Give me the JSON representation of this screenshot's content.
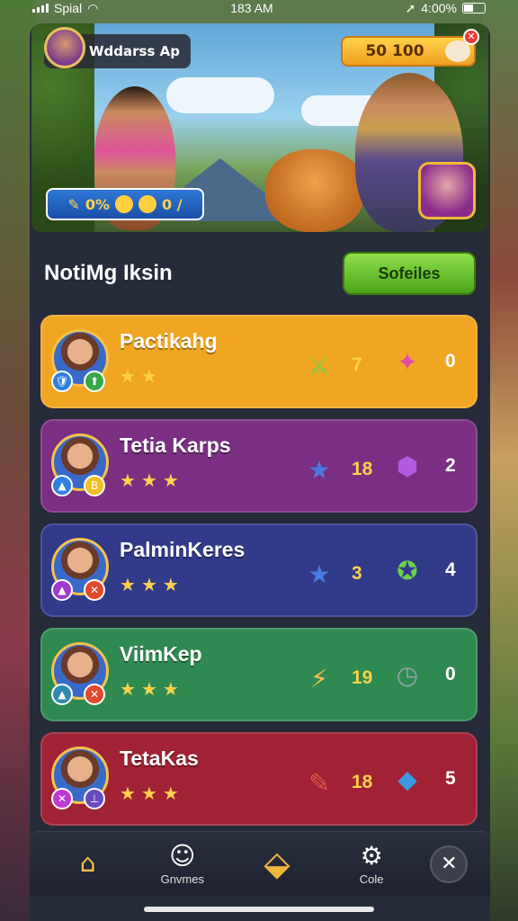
{
  "status_bar": {
    "carrier": "Spial",
    "time": "183 AM",
    "battery": "4:00%"
  },
  "hero": {
    "profile_name": "Wddarss Ap",
    "coins": "50 100",
    "stat": "0%",
    "stat_value": "0 /"
  },
  "section": {
    "title": "NotiMg Iksin",
    "action_label": "Sofeiles"
  },
  "players": [
    {
      "name": "Pactikahg",
      "stars": 2,
      "stat_a": "7",
      "stat_b": "0",
      "color": "#f0a622",
      "icon_a": "sword-icon",
      "icon_b": "ninja-icon",
      "badge_a_color": "#2f7fe0",
      "badge_b_color": "#3aa84a",
      "badge_a": "🛡",
      "badge_b": "⬆"
    },
    {
      "name": "Tetia Karps",
      "stars": 3,
      "stat_a": "18",
      "stat_b": "2",
      "color": "#7a2f82",
      "icon_a": "star-icon",
      "icon_b": "gem-icon",
      "badge_a_color": "#2f7fe0",
      "badge_b_color": "#f0c020",
      "badge_a": "▲",
      "badge_b": "B"
    },
    {
      "name": "PalminKeres",
      "stars": 3,
      "stat_a": "3",
      "stat_b": "4",
      "color": "#323a8a",
      "icon_a": "star-icon",
      "icon_b": "compass-icon",
      "badge_a_color": "#a03ad0",
      "badge_b_color": "#e04a2a",
      "badge_a": "▲",
      "badge_b": "✕"
    },
    {
      "name": "ViimKep",
      "stars": 3,
      "stat_a": "19",
      "stat_b": "0",
      "color": "#2f8a52",
      "icon_a": "lightning-icon",
      "icon_b": "clock-icon",
      "badge_a_color": "#2f8ab0",
      "badge_b_color": "#e04a2a",
      "badge_a": "▲",
      "badge_b": "✕"
    },
    {
      "name": "TetaKas",
      "stars": 3,
      "stat_a": "18",
      "stat_b": "5",
      "color": "#a02234",
      "icon_a": "brush-icon",
      "icon_b": "crystal-icon",
      "badge_a_color": "#c03ad0",
      "badge_b_color": "#6a4ac0",
      "badge_a": "✕",
      "badge_b": "⊥"
    }
  ],
  "bottom_nav": {
    "items": [
      {
        "label": "",
        "icon": "home-icon"
      },
      {
        "label": "Gnvmes",
        "icon": "profile-icon"
      },
      {
        "label": "",
        "icon": "treasure-icon"
      },
      {
        "label": "Cole",
        "icon": "gear-icon"
      }
    ],
    "close_icon": "close-icon"
  }
}
